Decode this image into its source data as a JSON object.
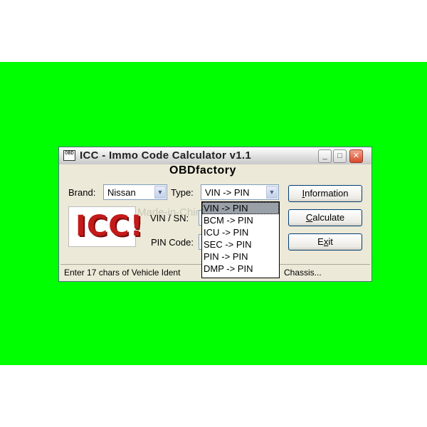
{
  "window": {
    "title": "ICC - Immo Code Calculator v1.1",
    "app_icon_text": "OBD",
    "brand_title": "OBDfactory"
  },
  "form": {
    "brand_label": "Brand:",
    "brand_value": "Nissan",
    "type_label": "Type:",
    "type_value": "VIN -> PIN",
    "vin_label": "VIN / SN:",
    "pin_label": "PIN Code:"
  },
  "logo": {
    "text": "ICC!"
  },
  "watermark": "Made-in-China",
  "buttons": {
    "information": {
      "accel": "I",
      "rest": "nformation"
    },
    "calculate": {
      "accel": "C",
      "rest": "alculate"
    },
    "exit": {
      "pre": "E",
      "accel": "x",
      "rest": "it"
    }
  },
  "type_options": [
    "VIN -> PIN",
    "BCM -> PIN",
    "ICU -> PIN",
    "SEC -> PIN",
    "PIN -> PIN",
    "DMP -> PIN"
  ],
  "type_selected_index": 0,
  "status": {
    "left": "Enter 17 chars of Vehicle Ident",
    "right": "Chassis..."
  },
  "colors": {
    "background_green": "#00ff00",
    "logo_red": "#c31a1a"
  }
}
